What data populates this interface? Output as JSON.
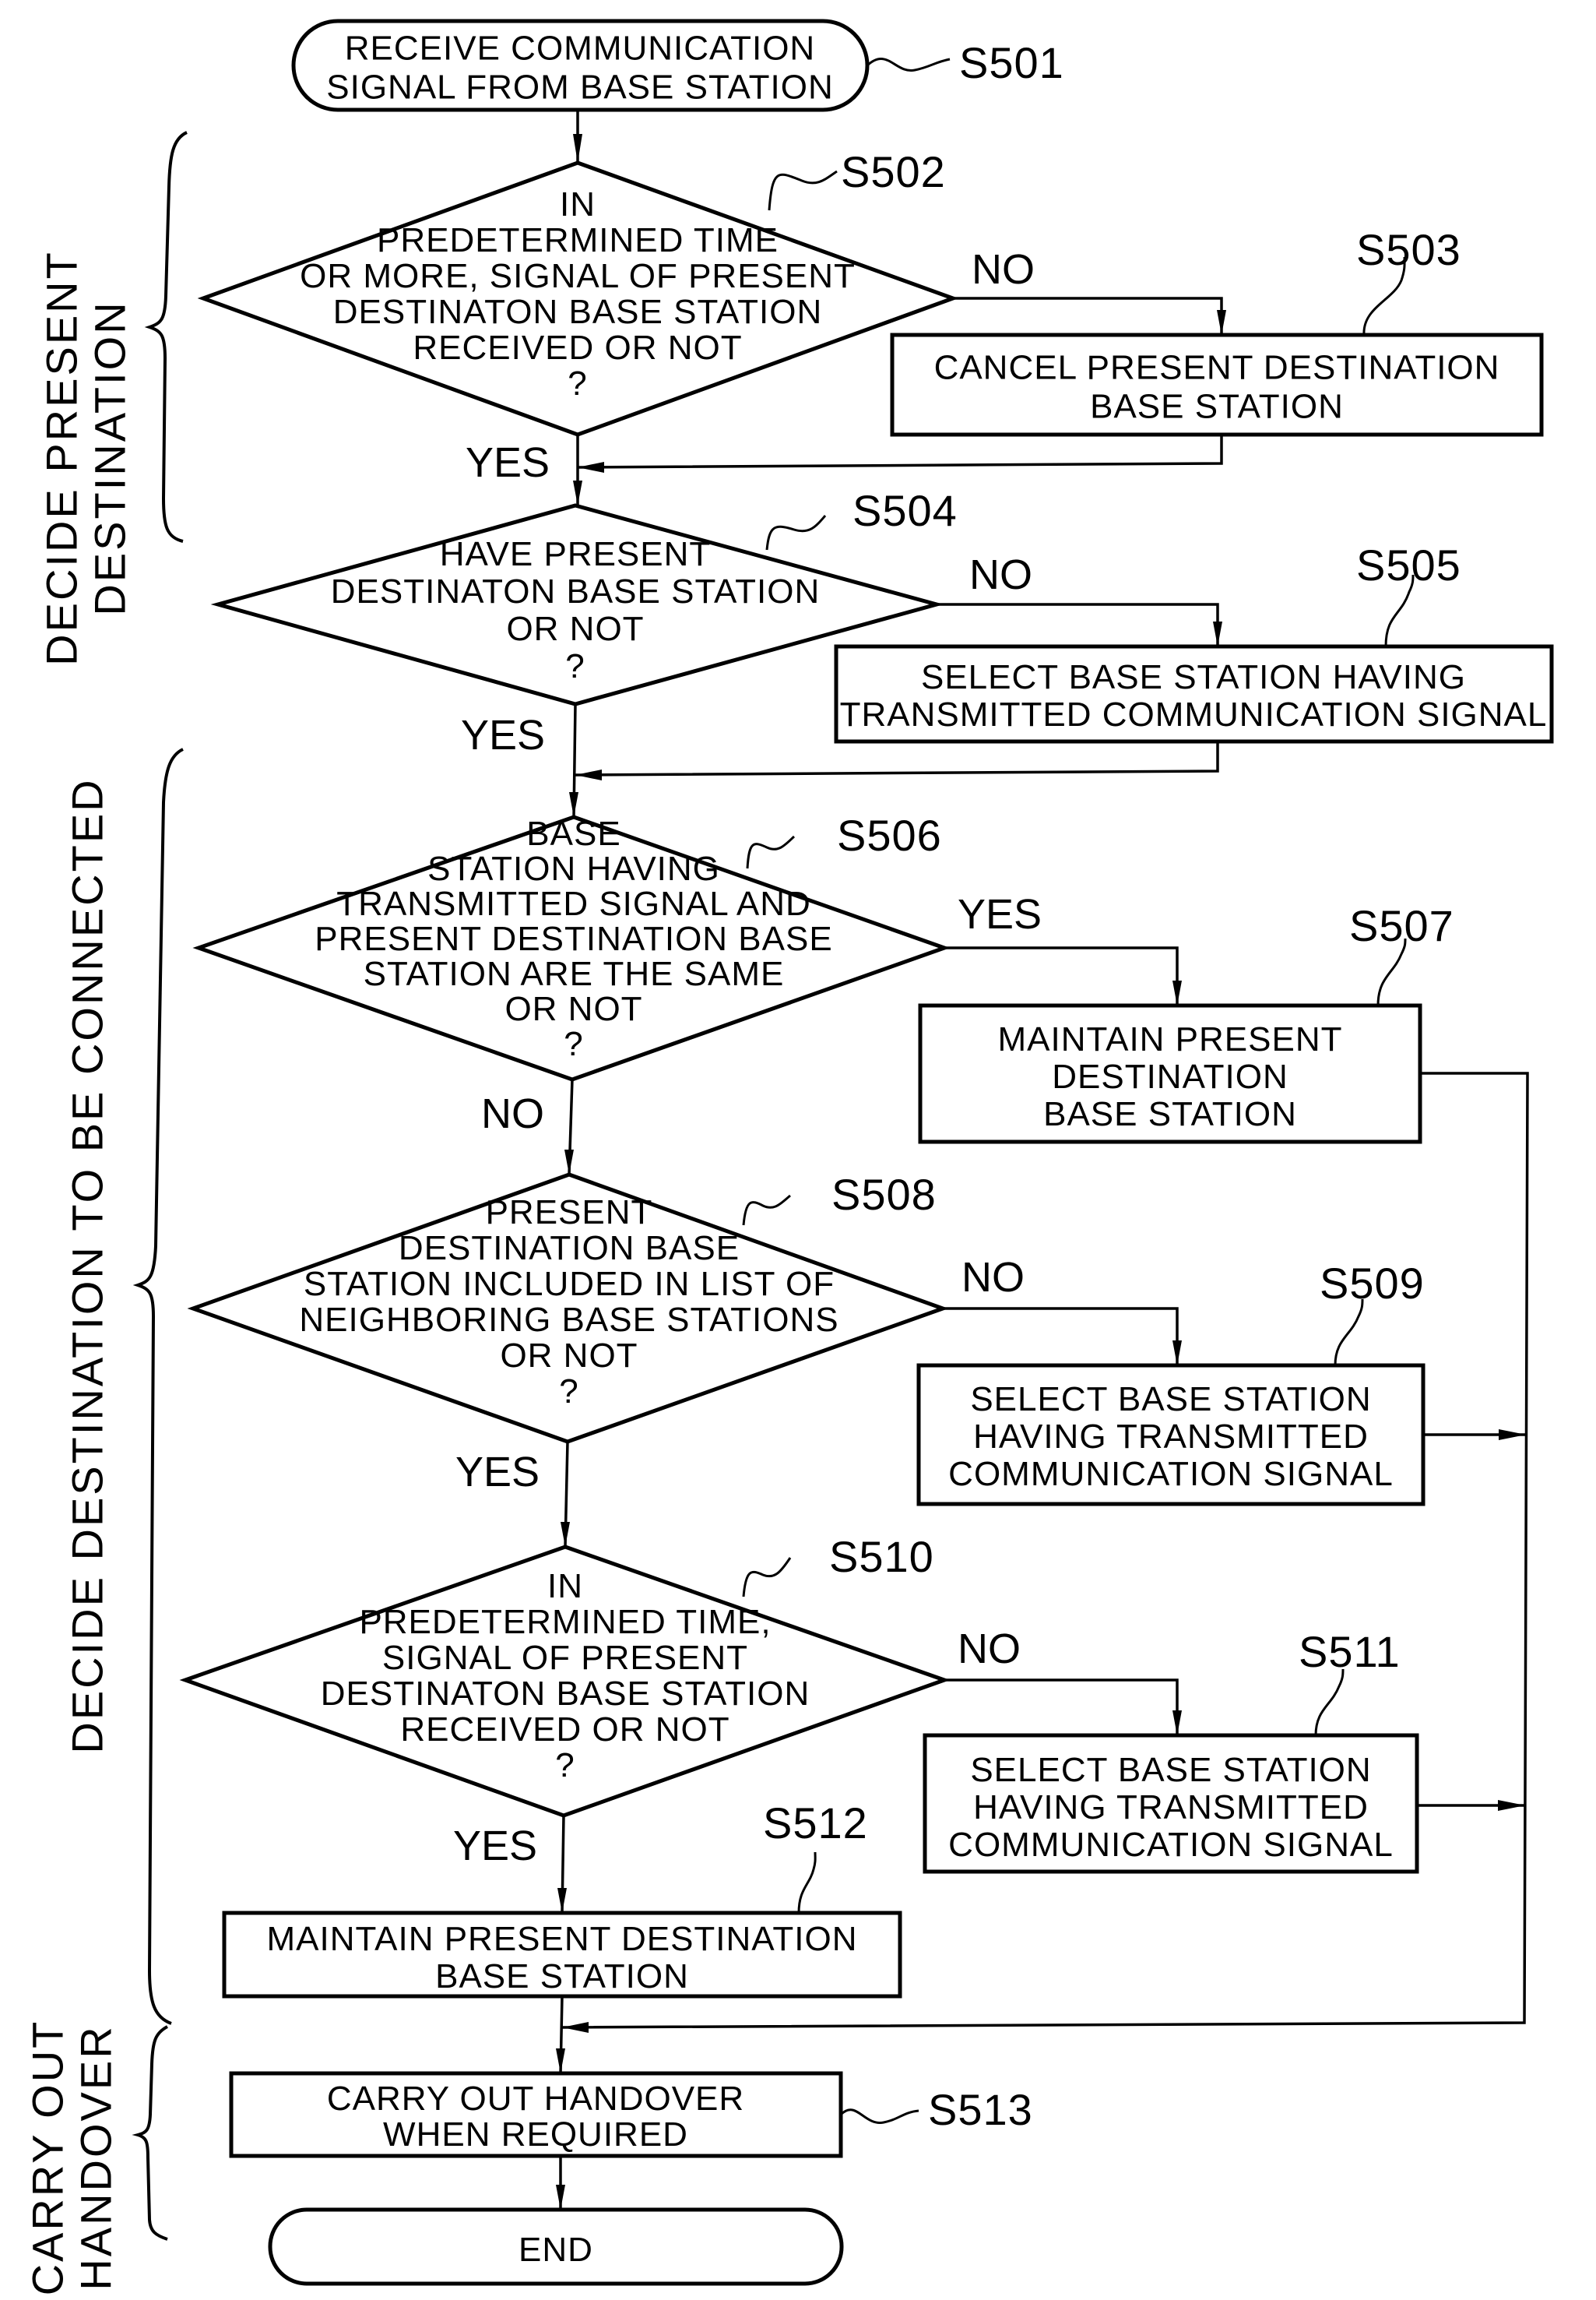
{
  "diagram": {
    "type": "flowchart",
    "phases": [
      {
        "id": "decide-present-destination",
        "lines": [
          "DECIDE PRESENT",
          "DESTINATION"
        ]
      },
      {
        "id": "decide-destination-to-be-connected",
        "lines": [
          "DECIDE DESTINATION TO BE CONNECTED"
        ]
      },
      {
        "id": "carry-out-handover",
        "lines": [
          "CARRY OUT",
          "HANDOVER"
        ]
      }
    ],
    "nodes": {
      "S501": {
        "step": "S501",
        "kind": "terminal",
        "lines": [
          "RECEIVE COMMUNICATION",
          "SIGNAL FROM BASE STATION"
        ]
      },
      "S502": {
        "step": "S502",
        "kind": "decision",
        "lines": [
          "IN",
          "PREDETERMINED TIME",
          "OR MORE, SIGNAL OF PRESENT",
          "DESTINATON BASE STATION",
          "RECEIVED OR NOT",
          "?"
        ]
      },
      "S503": {
        "step": "S503",
        "kind": "process",
        "lines": [
          "CANCEL PRESENT DESTINATION",
          "BASE STATION"
        ]
      },
      "S504": {
        "step": "S504",
        "kind": "decision",
        "lines": [
          "HAVE PRESENT",
          "DESTINATON BASE STATION",
          "OR NOT",
          "?"
        ]
      },
      "S505": {
        "step": "S505",
        "kind": "process",
        "lines": [
          "SELECT BASE STATION HAVING",
          "TRANSMITTED COMMUNICATION SIGNAL"
        ]
      },
      "S506": {
        "step": "S506",
        "kind": "decision",
        "lines": [
          "BASE",
          "STATION HAVING",
          "TRANSMITTED SIGNAL AND",
          "PRESENT DESTINATION BASE",
          "STATION ARE THE SAME",
          "OR NOT",
          "?"
        ]
      },
      "S507": {
        "step": "S507",
        "kind": "process",
        "lines": [
          "MAINTAIN PRESENT",
          "DESTINATION",
          "BASE STATION"
        ]
      },
      "S508": {
        "step": "S508",
        "kind": "decision",
        "lines": [
          "PRESENT",
          "DESTINATION BASE",
          "STATION INCLUDED IN LIST OF",
          "NEIGHBORING BASE STATIONS",
          "OR NOT",
          "?"
        ]
      },
      "S509": {
        "step": "S509",
        "kind": "process",
        "lines": [
          "SELECT BASE STATION",
          "HAVING TRANSMITTED",
          "COMMUNICATION SIGNAL"
        ]
      },
      "S510": {
        "step": "S510",
        "kind": "decision",
        "lines": [
          "IN",
          "PREDETERMINED TIME,",
          "SIGNAL OF PRESENT",
          "DESTINATON BASE STATION",
          "RECEIVED OR NOT",
          "?"
        ]
      },
      "S511": {
        "step": "S511",
        "kind": "process",
        "lines": [
          "SELECT BASE STATION",
          "HAVING TRANSMITTED",
          "COMMUNICATION SIGNAL"
        ]
      },
      "S512": {
        "step": "S512",
        "kind": "process",
        "lines": [
          "MAINTAIN PRESENT DESTINATION",
          "BASE STATION"
        ]
      },
      "S513": {
        "step": "S513",
        "kind": "process",
        "lines": [
          "CARRY OUT HANDOVER",
          "WHEN REQUIRED"
        ]
      },
      "END": {
        "step": "",
        "kind": "terminal",
        "lines": [
          "END"
        ]
      }
    },
    "branch_labels": {
      "S502_no": "NO",
      "S502_yes": "YES",
      "S504_no": "NO",
      "S504_yes": "YES",
      "S506_yes": "YES",
      "S506_no": "NO",
      "S508_no": "NO",
      "S508_yes": "YES",
      "S510_no": "NO",
      "S510_yes": "YES"
    },
    "edges": [
      {
        "from": "S501",
        "to": "S502",
        "label": ""
      },
      {
        "from": "S502",
        "to": "S503",
        "label": "NO"
      },
      {
        "from": "S502",
        "to": "S504",
        "label": "YES"
      },
      {
        "from": "S503",
        "to": "S504",
        "label": ""
      },
      {
        "from": "S504",
        "to": "S505",
        "label": "NO"
      },
      {
        "from": "S504",
        "to": "S506",
        "label": "YES"
      },
      {
        "from": "S505",
        "to": "S506",
        "label": ""
      },
      {
        "from": "S506",
        "to": "S507",
        "label": "YES"
      },
      {
        "from": "S506",
        "to": "S508",
        "label": "NO"
      },
      {
        "from": "S508",
        "to": "S509",
        "label": "NO"
      },
      {
        "from": "S508",
        "to": "S510",
        "label": "YES"
      },
      {
        "from": "S510",
        "to": "S511",
        "label": "NO"
      },
      {
        "from": "S510",
        "to": "S512",
        "label": "YES"
      },
      {
        "from": "S507",
        "to": "S513",
        "label": ""
      },
      {
        "from": "S509",
        "to": "S513",
        "label": ""
      },
      {
        "from": "S511",
        "to": "S513",
        "label": ""
      },
      {
        "from": "S512",
        "to": "S513",
        "label": ""
      },
      {
        "from": "S513",
        "to": "END",
        "label": ""
      }
    ]
  }
}
